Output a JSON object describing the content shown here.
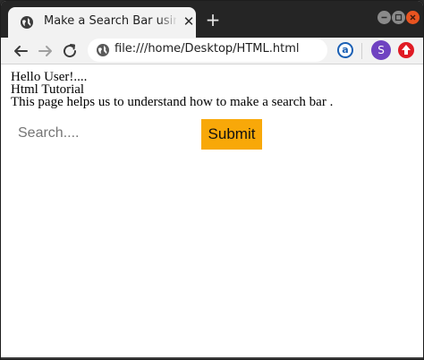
{
  "browser": {
    "tab": {
      "title": "Make a Search Bar using H",
      "close_glyph": "✕",
      "favicon": "globe-icon"
    },
    "new_tab_glyph": "+",
    "window_controls": [
      "minimize-icon",
      "maximize-icon",
      "close-icon"
    ],
    "address_bar": {
      "url": "file:///home/Desktop/HTML.html",
      "icon": "globe-icon"
    },
    "extensions": {
      "a_badge": "a",
      "avatar_letter": "S",
      "avatar_color": "#6f42c1",
      "upload_icon": "red-up-arrow-icon"
    },
    "accent_close_color": "#e95420"
  },
  "page": {
    "lines": [
      "Hello User!....",
      "Html Tutorial",
      "This page helps us to understand how to make a search bar ."
    ],
    "search": {
      "placeholder": "Search....",
      "value": ""
    },
    "submit_label": "Submit",
    "submit_color": "#f8a809"
  }
}
